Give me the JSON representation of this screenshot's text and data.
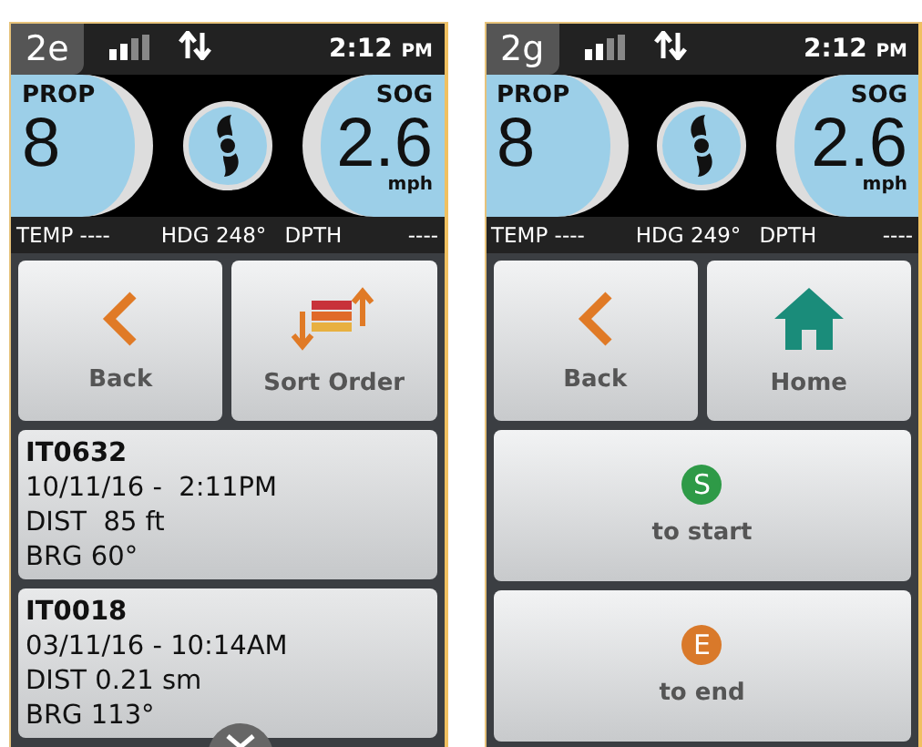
{
  "screens": [
    {
      "badge": "2e",
      "time": "2:12",
      "time_suffix": "PM",
      "prop": {
        "label": "PROP",
        "value": "8"
      },
      "sog": {
        "label": "SOG",
        "value": "2.6",
        "unit": "mph"
      },
      "info": [
        "TEMP ----",
        "HDG 248°",
        "DPTH",
        "----"
      ],
      "buttons": [
        {
          "kind": "back",
          "label": "Back"
        },
        {
          "kind": "sort",
          "label": "Sort Order"
        }
      ],
      "rows": [
        {
          "kind": "track",
          "title": "IT0632",
          "lines": [
            "10/11/16 -  2:11PM",
            "DIST  85 ft",
            "BRG 60°"
          ]
        },
        {
          "kind": "track",
          "title": "IT0018",
          "lines": [
            "03/11/16 - 10:14AM",
            "DIST 0.21 sm",
            "BRG 113°"
          ]
        }
      ],
      "scroll_down": true
    },
    {
      "badge": "2g",
      "time": "2:12",
      "time_suffix": "PM",
      "prop": {
        "label": "PROP",
        "value": "8"
      },
      "sog": {
        "label": "SOG",
        "value": "2.6",
        "unit": "mph"
      },
      "info": [
        "TEMP ----",
        "HDG 249°",
        "DPTH",
        "----"
      ],
      "buttons": [
        {
          "kind": "back",
          "label": "Back"
        },
        {
          "kind": "home",
          "label": "Home"
        }
      ],
      "rows": [
        {
          "kind": "action",
          "letter": "S",
          "label": "to start",
          "color": "#2e9a47"
        },
        {
          "kind": "action",
          "letter": "E",
          "label": "to end",
          "color": "#d9792a"
        }
      ]
    }
  ]
}
